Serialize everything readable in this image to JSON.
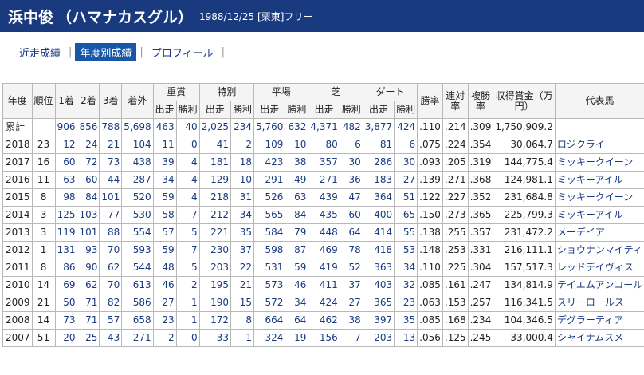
{
  "header": {
    "name": "浜中俊",
    "kana": "（ハマナカスグル）",
    "meta": "1988/12/25 [栗東]フリー"
  },
  "tabs": [
    {
      "label": "近走成績",
      "active": false
    },
    {
      "label": "年度別成績",
      "active": true
    },
    {
      "label": "プロフィール",
      "active": false
    }
  ],
  "columns": {
    "year": "年度",
    "rank": "順位",
    "first": "1着",
    "second": "2着",
    "third": "3着",
    "other": "着外",
    "grade": "重賞",
    "special": "特別",
    "flat": "平場",
    "turf": "芝",
    "dirt": "ダート",
    "starts": "出走",
    "wins": "勝利",
    "win_rate": "勝率",
    "place_rate": "連対率",
    "show_rate": "複勝率",
    "earnings": "収得賞金（万円）",
    "horse": "代表馬"
  },
  "rows": [
    {
      "year": "累計",
      "rank": "",
      "first": "906",
      "second": "856",
      "third": "788",
      "other": "5,698",
      "g_s": "463",
      "g_w": "40",
      "s_s": "2,025",
      "s_w": "234",
      "f_s": "5,760",
      "f_w": "632",
      "t_s": "4,371",
      "t_w": "482",
      "d_s": "3,877",
      "d_w": "424",
      "win_rate": ".110",
      "place_rate": ".214",
      "show_rate": ".309",
      "earnings": "1,750,909.2",
      "horse": ""
    },
    {
      "year": "2018",
      "rank": "23",
      "first": "12",
      "second": "24",
      "third": "21",
      "other": "104",
      "g_s": "11",
      "g_w": "0",
      "s_s": "41",
      "s_w": "2",
      "f_s": "109",
      "f_w": "10",
      "t_s": "80",
      "t_w": "6",
      "d_s": "81",
      "d_w": "6",
      "win_rate": ".075",
      "place_rate": ".224",
      "show_rate": ".354",
      "earnings": "30,064.7",
      "horse": "ロジクライ"
    },
    {
      "year": "2017",
      "rank": "16",
      "first": "60",
      "second": "72",
      "third": "73",
      "other": "438",
      "g_s": "39",
      "g_w": "4",
      "s_s": "181",
      "s_w": "18",
      "f_s": "423",
      "f_w": "38",
      "t_s": "357",
      "t_w": "30",
      "d_s": "286",
      "d_w": "30",
      "win_rate": ".093",
      "place_rate": ".205",
      "show_rate": ".319",
      "earnings": "144,775.4",
      "horse": "ミッキークイーン"
    },
    {
      "year": "2016",
      "rank": "11",
      "first": "63",
      "second": "60",
      "third": "44",
      "other": "287",
      "g_s": "34",
      "g_w": "4",
      "s_s": "129",
      "s_w": "10",
      "f_s": "291",
      "f_w": "49",
      "t_s": "271",
      "t_w": "36",
      "d_s": "183",
      "d_w": "27",
      "win_rate": ".139",
      "place_rate": ".271",
      "show_rate": ".368",
      "earnings": "124,981.1",
      "horse": "ミッキーアイル"
    },
    {
      "year": "2015",
      "rank": "8",
      "first": "98",
      "second": "84",
      "third": "101",
      "other": "520",
      "g_s": "59",
      "g_w": "4",
      "s_s": "218",
      "s_w": "31",
      "f_s": "526",
      "f_w": "63",
      "t_s": "439",
      "t_w": "47",
      "d_s": "364",
      "d_w": "51",
      "win_rate": ".122",
      "place_rate": ".227",
      "show_rate": ".352",
      "earnings": "231,684.8",
      "horse": "ミッキークイーン"
    },
    {
      "year": "2014",
      "rank": "3",
      "first": "125",
      "second": "103",
      "third": "77",
      "other": "530",
      "g_s": "58",
      "g_w": "7",
      "s_s": "212",
      "s_w": "34",
      "f_s": "565",
      "f_w": "84",
      "t_s": "435",
      "t_w": "60",
      "d_s": "400",
      "d_w": "65",
      "win_rate": ".150",
      "place_rate": ".273",
      "show_rate": ".365",
      "earnings": "225,799.3",
      "horse": "ミッキーアイル"
    },
    {
      "year": "2013",
      "rank": "3",
      "first": "119",
      "second": "101",
      "third": "88",
      "other": "554",
      "g_s": "57",
      "g_w": "5",
      "s_s": "221",
      "s_w": "35",
      "f_s": "584",
      "f_w": "79",
      "t_s": "448",
      "t_w": "64",
      "d_s": "414",
      "d_w": "55",
      "win_rate": ".138",
      "place_rate": ".255",
      "show_rate": ".357",
      "earnings": "231,472.2",
      "horse": "メーデイア"
    },
    {
      "year": "2012",
      "rank": "1",
      "first": "131",
      "second": "93",
      "third": "70",
      "other": "593",
      "g_s": "59",
      "g_w": "7",
      "s_s": "230",
      "s_w": "37",
      "f_s": "598",
      "f_w": "87",
      "t_s": "469",
      "t_w": "78",
      "d_s": "418",
      "d_w": "53",
      "win_rate": ".148",
      "place_rate": ".253",
      "show_rate": ".331",
      "earnings": "216,111.1",
      "horse": "ショウナンマイティ"
    },
    {
      "year": "2011",
      "rank": "8",
      "first": "86",
      "second": "90",
      "third": "62",
      "other": "544",
      "g_s": "48",
      "g_w": "5",
      "s_s": "203",
      "s_w": "22",
      "f_s": "531",
      "f_w": "59",
      "t_s": "419",
      "t_w": "52",
      "d_s": "363",
      "d_w": "34",
      "win_rate": ".110",
      "place_rate": ".225",
      "show_rate": ".304",
      "earnings": "157,517.3",
      "horse": "レッドデイヴィス"
    },
    {
      "year": "2010",
      "rank": "14",
      "first": "69",
      "second": "62",
      "third": "70",
      "other": "613",
      "g_s": "46",
      "g_w": "2",
      "s_s": "195",
      "s_w": "21",
      "f_s": "573",
      "f_w": "46",
      "t_s": "411",
      "t_w": "37",
      "d_s": "403",
      "d_w": "32",
      "win_rate": ".085",
      "place_rate": ".161",
      "show_rate": ".247",
      "earnings": "134,814.9",
      "horse": "テイエムアンコール"
    },
    {
      "year": "2009",
      "rank": "21",
      "first": "50",
      "second": "71",
      "third": "82",
      "other": "586",
      "g_s": "27",
      "g_w": "1",
      "s_s": "190",
      "s_w": "15",
      "f_s": "572",
      "f_w": "34",
      "t_s": "424",
      "t_w": "27",
      "d_s": "365",
      "d_w": "23",
      "win_rate": ".063",
      "place_rate": ".153",
      "show_rate": ".257",
      "earnings": "116,341.5",
      "horse": "スリーロールス"
    },
    {
      "year": "2008",
      "rank": "14",
      "first": "73",
      "second": "71",
      "third": "57",
      "other": "658",
      "g_s": "23",
      "g_w": "1",
      "s_s": "172",
      "s_w": "8",
      "f_s": "664",
      "f_w": "64",
      "t_s": "462",
      "t_w": "38",
      "d_s": "397",
      "d_w": "35",
      "win_rate": ".085",
      "place_rate": ".168",
      "show_rate": ".234",
      "earnings": "104,346.5",
      "horse": "デグラーティア"
    },
    {
      "year": "2007",
      "rank": "51",
      "first": "20",
      "second": "25",
      "third": "43",
      "other": "271",
      "g_s": "2",
      "g_w": "0",
      "s_s": "33",
      "s_w": "1",
      "f_s": "324",
      "f_w": "19",
      "t_s": "156",
      "t_w": "7",
      "d_s": "203",
      "d_w": "13",
      "win_rate": ".056",
      "place_rate": ".125",
      "show_rate": ".245",
      "earnings": "33,000.4",
      "horse": "シャイナムスメ"
    }
  ]
}
